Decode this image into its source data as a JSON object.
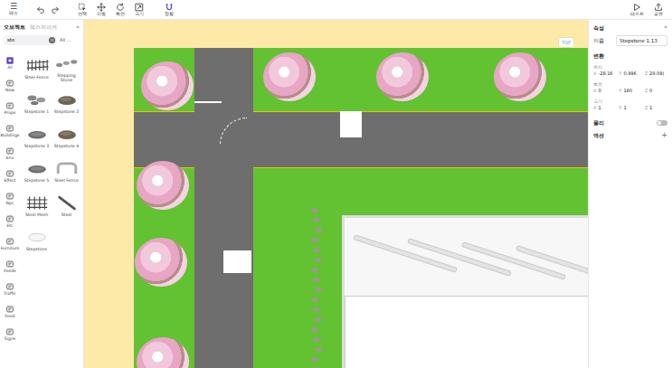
{
  "toolbar": {
    "menu": {
      "icon": "☰",
      "label": "메뉴"
    },
    "tools": [
      {
        "label": "선택",
        "kind": "select"
      },
      {
        "label": "이동",
        "kind": "move"
      },
      {
        "label": "회전",
        "kind": "rotate"
      },
      {
        "label": "크기",
        "kind": "scale"
      },
      {
        "label": "정렬",
        "kind": "magnet"
      }
    ],
    "actions": [
      {
        "label": "테스트",
        "kind": "play"
      },
      {
        "label": "공유",
        "kind": "share"
      }
    ]
  },
  "library": {
    "tabs": [
      {
        "label": "오브젝트",
        "selected": true
      },
      {
        "label": "텍스처피커",
        "selected": false
      }
    ],
    "collapse": "«",
    "search": {
      "value": "ste",
      "clear": "×"
    },
    "filter": "All ...",
    "categories": [
      {
        "label": "All",
        "selected": true
      },
      {
        "label": "New",
        "selected": false
      },
      {
        "label": "Props",
        "selected": false
      },
      {
        "label": "Buildings",
        "selected": false
      },
      {
        "label": "Env",
        "selected": false
      },
      {
        "label": "Effect",
        "selected": false
      },
      {
        "label": "Npc",
        "selected": false
      },
      {
        "label": "Etc",
        "selected": false
      },
      {
        "label": "Furniture",
        "selected": false
      },
      {
        "label": "Feeds",
        "selected": false
      },
      {
        "label": "Traffic",
        "selected": false
      },
      {
        "label": "Food",
        "selected": false
      },
      {
        "label": "Signs",
        "selected": false
      }
    ],
    "items": [
      {
        "label": "Steel Fence",
        "kind": "fence"
      },
      {
        "label": "Stepping Stone",
        "kind": "stones"
      },
      {
        "label": "Stepstone 1",
        "kind": "stonegroup"
      },
      {
        "label": "Stepstone 2",
        "kind": "rock"
      },
      {
        "label": "Stepstone 3",
        "kind": "flat"
      },
      {
        "label": "Stepstone 4",
        "kind": "rock"
      },
      {
        "label": "Stepstone 5",
        "kind": "flat"
      },
      {
        "label": "Steel Fence",
        "kind": "rail"
      },
      {
        "label": "Steel Mesh",
        "kind": "mesh"
      },
      {
        "label": "Steel",
        "kind": "bar"
      },
      {
        "label": "Stepstone",
        "kind": "slab"
      }
    ]
  },
  "canvas": {
    "view_button": "TOP"
  },
  "properties": {
    "title": "속성",
    "collapse": "»",
    "name": {
      "label": "이름",
      "value": "Stepstone 1.13"
    },
    "transform": {
      "title": "변환",
      "rows": [
        {
          "label": "위치",
          "values": [
            {
              "axis": "X",
              "value": "-28.16"
            },
            {
              "axis": "Y",
              "value": "0.996"
            },
            {
              "axis": "Z",
              "value": "29.08("
            }
          ]
        },
        {
          "label": "회전",
          "values": [
            {
              "axis": "X",
              "value": "0"
            },
            {
              "axis": "Y",
              "value": "180"
            },
            {
              "axis": "Z",
              "value": "0"
            }
          ]
        },
        {
          "label": "크기",
          "values": [
            {
              "axis": "X",
              "value": "1"
            },
            {
              "axis": "Y",
              "value": "1"
            },
            {
              "axis": "Z",
              "value": "1"
            }
          ]
        }
      ]
    },
    "physics": {
      "label": "물리",
      "on": false
    },
    "action": {
      "label": "액션",
      "add": "+"
    }
  }
}
